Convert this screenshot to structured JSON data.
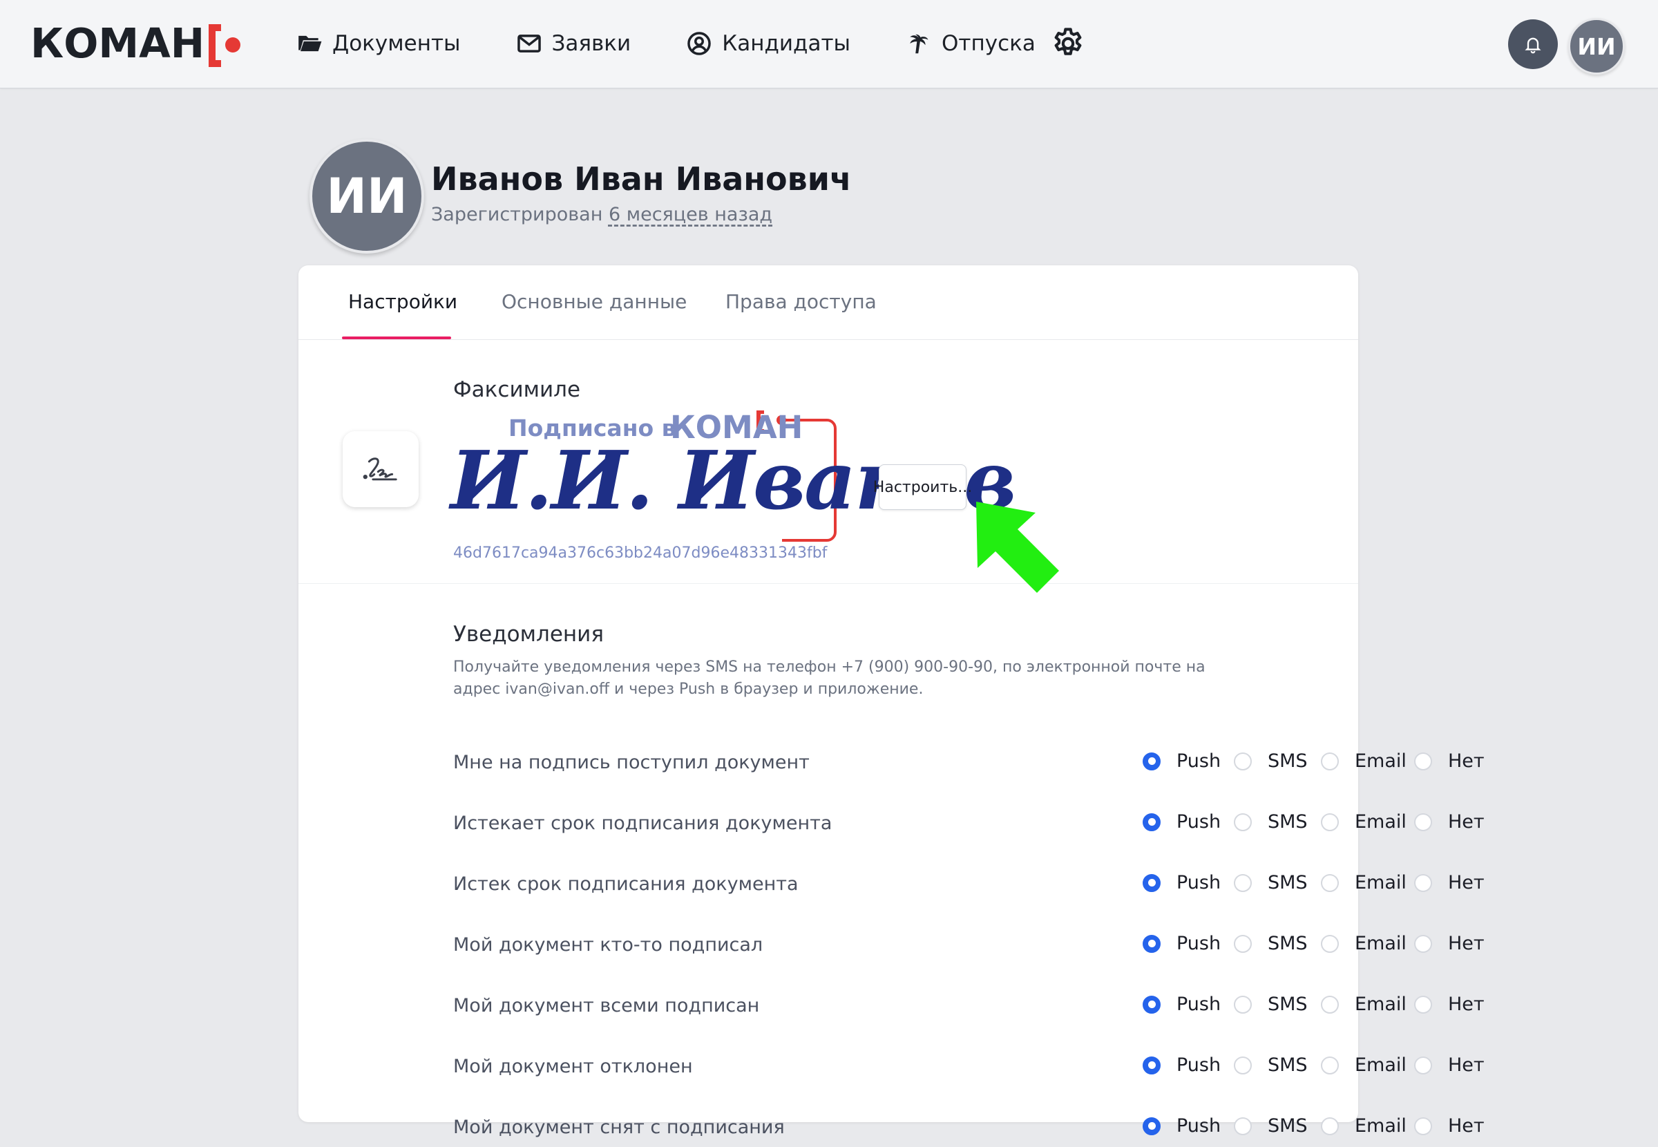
{
  "brand": {
    "name": "КОМАН",
    "accent": "#e53935"
  },
  "nav": {
    "items": [
      {
        "label": "Документы",
        "icon": "folder-open-icon"
      },
      {
        "label": "Заявки",
        "icon": "envelope-icon"
      },
      {
        "label": "Кандидаты",
        "icon": "user-circle-icon"
      },
      {
        "label": "Отпуска",
        "icon": "palm-tree-icon"
      }
    ],
    "settings_icon": "gear-icon"
  },
  "header": {
    "bell_icon": "bell-icon",
    "avatar_initials": "ИИ"
  },
  "profile": {
    "initials": "ИИ",
    "name": "Иванов Иван Иванович",
    "registered_prefix": "Зарегистрирован",
    "registered_ago": "6 месяцев назад"
  },
  "tabs": [
    {
      "label": "Настройки",
      "active": true
    },
    {
      "label": "Основные данные",
      "active": false
    },
    {
      "label": "Права доступа",
      "active": false
    }
  ],
  "facsimile": {
    "title": "Факсимиле",
    "icon": "signature-icon",
    "signed_in": "Подписано в",
    "brand": "КОМАН",
    "signature_text": "И.И. Иванов",
    "hash": "46d7617ca94a376c63bb24a07d96e48331343fbf",
    "configure_label": "Настроить..."
  },
  "notifications": {
    "title": "Уведомления",
    "description": "Получайте уведомления через SMS на телефон +7 (900) 900-90-90, по электронной почте на адрес ivan@ivan.off и через Push в браузер и приложение.",
    "options": [
      "Push",
      "SMS",
      "Email",
      "Нет"
    ],
    "rows": [
      {
        "label": "Мне на подпись поступил документ",
        "selected": "Push"
      },
      {
        "label": "Истекает срок подписания документа",
        "selected": "Push"
      },
      {
        "label": "Истек срок подписания документа",
        "selected": "Push"
      },
      {
        "label": "Мой документ кто-то подписал",
        "selected": "Push"
      },
      {
        "label": "Мой документ всеми подписан",
        "selected": "Push"
      },
      {
        "label": "Мой документ отклонен",
        "selected": "Push"
      },
      {
        "label": "Мой документ снят с подписания",
        "selected": "Push"
      }
    ]
  },
  "colors": {
    "accent_tab": "#e91e63",
    "radio_on": "#2563eb",
    "hint_arrow": "#22ee11"
  }
}
